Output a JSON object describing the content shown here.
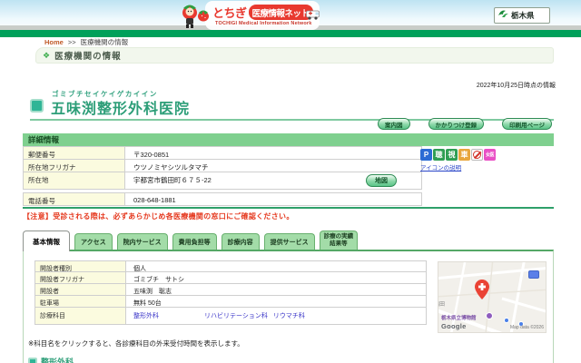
{
  "colors": {
    "accent_green": "#00A05A",
    "link_blue": "#3A35C8",
    "caution_red": "#E5391F"
  },
  "header": {
    "site_name_1": "とちぎ",
    "site_name_2": "医療情報ネット",
    "subtitle": "TOCHIGI Medical Information Network",
    "prefecture": "栃木県"
  },
  "breadcrumb": {
    "home": "Home",
    "separator": ">>",
    "current": "医療機関の情報"
  },
  "page_title_icon": "❖",
  "page_title": "医療機関の情報",
  "as_of": "2022年10月25日時点の情報",
  "hospital": {
    "furigana": "ゴミブチセイケイゲカイイン",
    "name": "五味渕整形外科医院"
  },
  "actions": {
    "guide_map": "案内図",
    "family_registration": "かかりつけ登録",
    "print_page": "印刷用ページ"
  },
  "details": {
    "title": "詳細情報",
    "rows": [
      {
        "label": "郵便番号",
        "value": "〒320-0851"
      },
      {
        "label": "所在地フリガナ",
        "value": "ウツノミヤシツルタマチ"
      },
      {
        "label": "所在地",
        "value": "宇都宮市鶴田町６７５-22",
        "map_button": "地図"
      },
      {
        "label": "電話番号",
        "value": "028-648-1881"
      }
    ],
    "icons": [
      {
        "glyph": "P",
        "bg": "#2B6BD4"
      },
      {
        "glyph": "聴",
        "bg": "#2F9E53"
      },
      {
        "glyph": "視",
        "bg": "#2F9E53"
      },
      {
        "glyph": "車",
        "bg": "#E8A63C"
      },
      {
        "glyph": "",
        "bg": "#FFFFFF"
      },
      {
        "glyph": "女医",
        "bg": "#E94FC5"
      }
    ],
    "icons_help": "アイコンの説明"
  },
  "caution": "【注意】受診される際は、必ずあらかじめ各医療機関の窓口にご確認ください。",
  "tabs": [
    {
      "label": "基本情報",
      "active": true
    },
    {
      "label": "アクセス"
    },
    {
      "label": "院内サービス"
    },
    {
      "label": "費用負担等"
    },
    {
      "label": "診療内容"
    },
    {
      "label": "提供サービス"
    },
    {
      "label": "診療の実績\n結果等"
    }
  ],
  "basic_info": {
    "rows": [
      {
        "label": "開設者種別",
        "value": "個人"
      },
      {
        "label": "開設者フリガナ",
        "value": "ゴミブチ　サトシ"
      },
      {
        "label": "開設者",
        "value": "五味渕　聡志"
      },
      {
        "label": "駐車場",
        "value": "無料 50台"
      }
    ],
    "dept_label": "診療科目",
    "dept_links": [
      "整形外科",
      "リハビリテーション科",
      "リウマチ科"
    ]
  },
  "map": {
    "place": "栃木県立博物館",
    "area": "鶴田",
    "google": "Google",
    "attribution": "Map data ©2026"
  },
  "footnote": "※科目名をクリックすると、各診療科目の外来受付時間を表示します。",
  "next_section": "整形外科"
}
